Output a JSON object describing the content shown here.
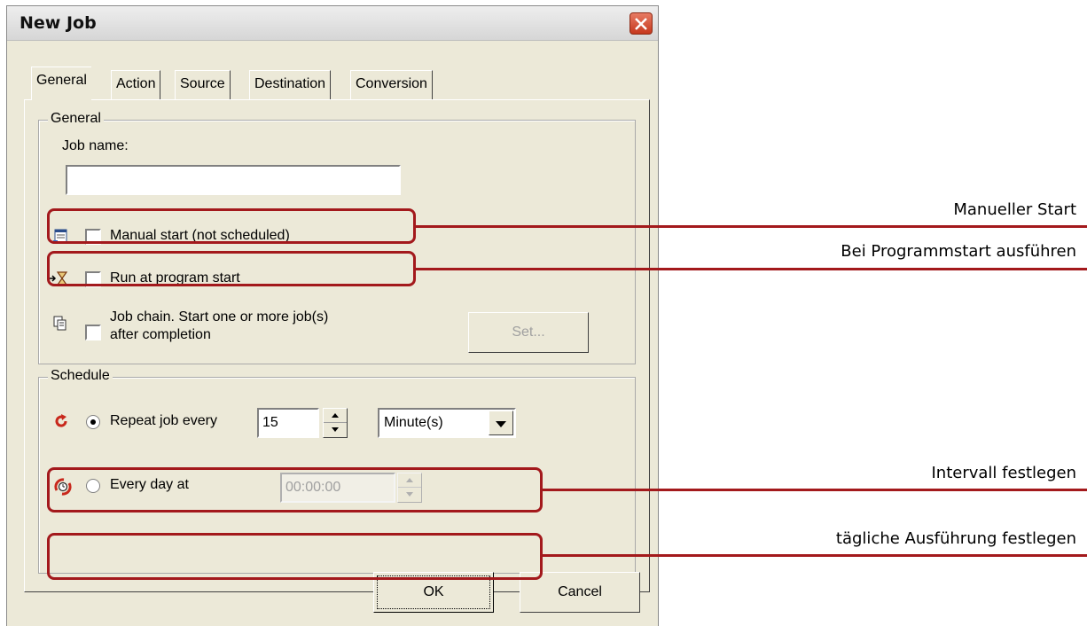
{
  "dialog": {
    "title": "New Job"
  },
  "tabs": [
    "General",
    "Action",
    "Source",
    "Destination",
    "Conversion"
  ],
  "general": {
    "group_label": "General",
    "job_name_label": "Job name:",
    "job_name_value": "",
    "manual_start_label": "Manual start (not scheduled)",
    "run_at_start_label": "Run at program start",
    "job_chain_line1": "Job chain. Start one or more job(s)",
    "job_chain_line2": "after completion",
    "set_button": "Set..."
  },
  "schedule": {
    "group_label": "Schedule",
    "repeat_label": "Repeat job every",
    "repeat_value": "15",
    "unit_value": "Minute(s)",
    "every_day_label": "Every day at",
    "time_value": "00:00:00"
  },
  "buttons": {
    "ok": "OK",
    "cancel": "Cancel"
  },
  "annotations": {
    "manual_start": "Manueller Start",
    "program_start": "Bei Programmstart ausführen",
    "interval": "Intervall festlegen",
    "daily": "tägliche Ausführung festlegen"
  },
  "colors": {
    "annotation": "#a3191c",
    "dialog_bg": "#ece9d8"
  }
}
